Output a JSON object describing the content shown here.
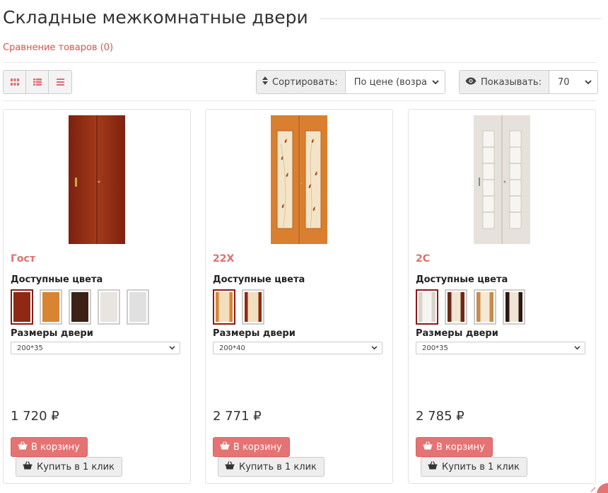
{
  "page": {
    "title": "Складные межкомнатные двери"
  },
  "compare": {
    "label": "Сравнение товаров (0)"
  },
  "toolbar": {
    "views": [
      {
        "icon": "grid-icon"
      },
      {
        "icon": "list-icon"
      },
      {
        "icon": "compact-list-icon"
      }
    ],
    "sort": {
      "icon": "sort-icon",
      "label": "Сортировать:",
      "value": "По цене (возра"
    },
    "show": {
      "icon": "eye-icon",
      "label": "Показывать:",
      "value": "70"
    }
  },
  "colors": {
    "accent": "#e57373",
    "name": "#e06e6e",
    "selected_border": "#8b1a1a"
  },
  "products": [
    {
      "name": "Гост",
      "colors_label": "Доступные цвета",
      "size_label": "Размеры двери",
      "size_value": "200*35",
      "price": "1 720 ₽",
      "cart_label": "В корзину",
      "buy_label": "Купить в 1 клик",
      "swatches": [
        "#8e2a14",
        "#d98433",
        "#3b2116",
        "#e8e4df",
        "#e0e0e0"
      ]
    },
    {
      "name": "22Х",
      "colors_label": "Доступные цвета",
      "size_label": "Размеры двери",
      "size_value": "200*40",
      "price": "2 771 ₽",
      "cart_label": "В корзину",
      "buy_label": "Купить в 1 клик",
      "swatches": [
        "#d98433",
        "#8e2a14"
      ]
    },
    {
      "name": "2С",
      "colors_label": "Доступные цвета",
      "size_label": "Размеры двери",
      "size_value": "200*35",
      "price": "2 785 ₽",
      "cart_label": "В корзину",
      "buy_label": "Купить в 1 клик",
      "swatches": [
        "#e8e4df",
        "#6b2a16",
        "#c98a4a",
        "#2c1810"
      ]
    }
  ]
}
